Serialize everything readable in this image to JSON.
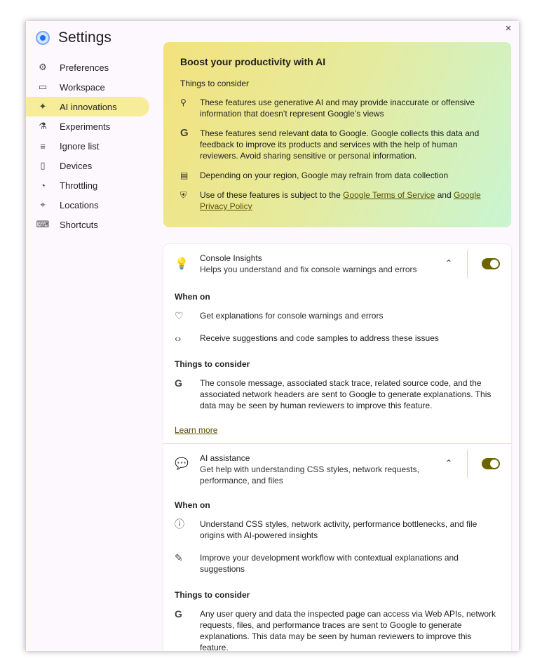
{
  "window": {
    "close_label": "×"
  },
  "sidebar": {
    "title": "Settings",
    "items": [
      {
        "label": "Preferences",
        "icon": "⚙"
      },
      {
        "label": "Workspace",
        "icon": "▭"
      },
      {
        "label": "AI innovations",
        "icon": "✦"
      },
      {
        "label": "Experiments",
        "icon": "⚗"
      },
      {
        "label": "Ignore list",
        "icon": "≡"
      },
      {
        "label": "Devices",
        "icon": "▯"
      },
      {
        "label": "Throttling",
        "icon": "◔"
      },
      {
        "label": "Locations",
        "icon": "⌖"
      },
      {
        "label": "Shortcuts",
        "icon": "⌨"
      }
    ],
    "active_index": 2
  },
  "banner": {
    "title": "Boost your productivity with AI",
    "subtitle": "Things to consider",
    "rows": [
      {
        "icon": "⚲",
        "text": "These features use generative AI and may provide inaccurate or offensive information that doesn’t represent Google’s views"
      },
      {
        "icon": "G",
        "text": "These features send relevant data to Google. Google collects this data and feedback to improve its products and services with the help of human reviewers. Avoid sharing sensitive or personal information."
      },
      {
        "icon": "▤",
        "text": "Depending on your region, Google may refrain from data collection"
      }
    ],
    "terms": {
      "prefix": "Use of these features is subject to the ",
      "tos_link": "Google Terms of Service",
      "middle": " and ",
      "privacy_link": "Google Privacy Policy"
    }
  },
  "console_insights": {
    "title": "Console Insights",
    "subtitle": "Helps you understand and fix console warnings and errors",
    "chevron": "⌃",
    "toggle_on": true,
    "when_on_title": "When on",
    "when_on": [
      {
        "icon": "♡",
        "text": "Get explanations for console warnings and errors"
      },
      {
        "icon": "‹›",
        "text": "Receive suggestions and code samples to address these issues"
      }
    ],
    "consider_title": "Things to consider",
    "consider": [
      {
        "icon": "G",
        "text": "The console message, associated stack trace, related source code, and the associated network headers are sent to Google to generate explanations. This data may be seen by human reviewers to improve this feature."
      }
    ],
    "learn_more": "Learn more"
  },
  "ai_assistance": {
    "title": "AI assistance",
    "subtitle": "Get help with understanding CSS styles, network requests, performance, and files",
    "chevron": "⌃",
    "toggle_on": true,
    "when_on_title": "When on",
    "when_on": [
      {
        "icon": "ⓘ",
        "text": "Understand CSS styles, network activity, performance bottlenecks, and file origins with AI-powered insights"
      },
      {
        "icon": "✎",
        "text": "Improve your development workflow with contextual explanations and suggestions"
      }
    ],
    "consider_title": "Things to consider",
    "consider": [
      {
        "icon": "G",
        "text": "Any user query and data the inspected page can access via Web APIs, network requests, files, and performance traces are sent to Google to generate explanations. This data may be seen by human reviewers to improve this feature."
      }
    ]
  }
}
